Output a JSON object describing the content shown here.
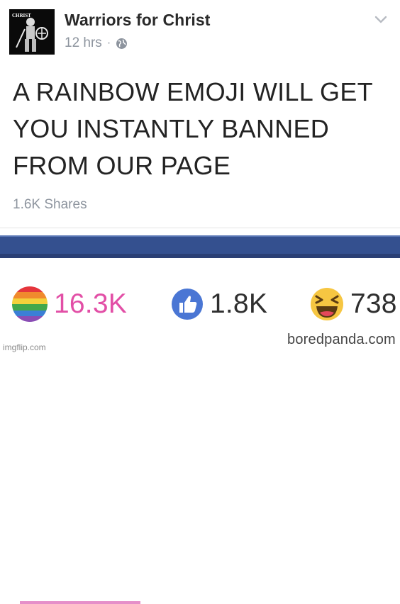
{
  "post": {
    "page_name": "Warriors for Christ",
    "avatar_label": "CHRIST",
    "timestamp": "12 hrs",
    "separator": "·",
    "privacy_icon": "globe-icon",
    "menu_icon": "chevron-down-icon",
    "text": "A RAINBOW EMOJI WILL GET\nYOU INSTANTLY BANNED\nFROM OUR PAGE",
    "shares": "1.6K Shares"
  },
  "reactions": [
    {
      "icon": "rainbow-emoji-icon",
      "count": "16.3K",
      "color": "#e24fa6"
    },
    {
      "icon": "like-icon",
      "count": "1.8K",
      "color": "#2f2f2f"
    },
    {
      "icon": "haha-emoji-icon",
      "count": "738",
      "color": "#2f2f2f"
    }
  ],
  "credit": "boredpanda.com",
  "watermark": "imgflip.com",
  "colors": {
    "brand_bar": "#34508f",
    "accent_pink": "#e58fc9",
    "like_blue": "#4a76d4",
    "haha_yellow": "#f6c642"
  }
}
